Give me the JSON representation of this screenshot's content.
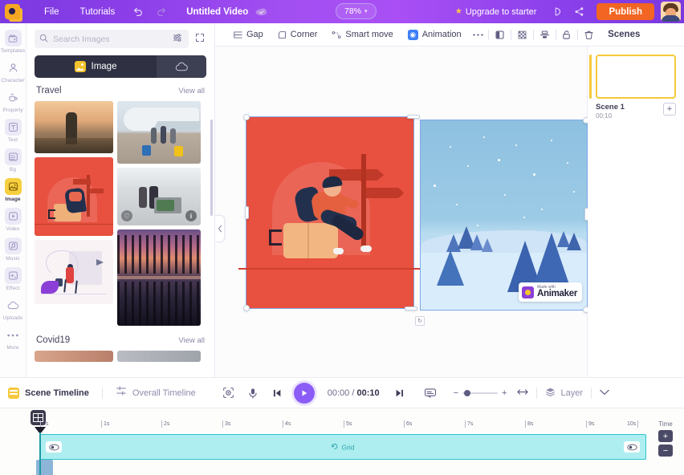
{
  "topbar": {
    "logo": "animaker-logo",
    "menu": [
      {
        "label": "File",
        "name": "file-menu"
      },
      {
        "label": "Tutorials",
        "name": "tutorials-menu"
      }
    ],
    "undo_icon": "undo-icon",
    "redo_icon": "redo-icon",
    "doc_title": "Untitled Video",
    "cloud_icon": "cloud-save-icon",
    "zoom_level": "78%",
    "zoom_caret": "▾",
    "upgrade_label": "Upgrade to starter",
    "upgrade_star": "★",
    "present_icon": "present-icon",
    "share_icon": "share-icon",
    "publish_label": "Publish",
    "avatar": "user-avatar"
  },
  "rail": {
    "items": [
      {
        "label": "Templates",
        "icon": "templates-icon",
        "glyph": "▤"
      },
      {
        "label": "Character",
        "icon": "character-icon",
        "glyph": "●"
      },
      {
        "label": "Property",
        "icon": "property-icon",
        "glyph": "☕"
      },
      {
        "label": "Text",
        "icon": "text-icon",
        "glyph": "T"
      },
      {
        "label": "Bg",
        "icon": "bg-icon",
        "glyph": "☰"
      },
      {
        "label": "Image",
        "icon": "image-icon",
        "glyph": "◰"
      },
      {
        "label": "Video",
        "icon": "video-icon",
        "glyph": "▶"
      },
      {
        "label": "Music",
        "icon": "music-icon",
        "glyph": "♪"
      },
      {
        "label": "Effect",
        "icon": "effect-icon",
        "glyph": "✦"
      },
      {
        "label": "Uploads",
        "icon": "uploads-icon",
        "glyph": "☁"
      },
      {
        "label": "More",
        "icon": "more-icon",
        "glyph": "●●●"
      }
    ],
    "active": "Image"
  },
  "library": {
    "search_placeholder": "Search Images",
    "search_value": "",
    "search_icon": "search-icon",
    "filter_icon": "filter-icon",
    "expand_icon": "expand-icon",
    "toggle_image_label": "Image",
    "toggle_cloud_icon": "cloud-icon",
    "sections": [
      {
        "title": "Travel",
        "view_all": "View all"
      },
      {
        "title": "Covid19",
        "view_all": "View all"
      }
    ]
  },
  "canvas_toolbar": {
    "items": [
      {
        "label": "Gap",
        "icon": "gap-icon"
      },
      {
        "label": "Corner",
        "icon": "corner-icon"
      },
      {
        "label": "Smart move",
        "icon": "smart-move-icon"
      },
      {
        "label": "Animation",
        "icon": "animation-icon"
      }
    ],
    "right_icons": [
      {
        "name": "more-options-icon",
        "glyph": "⋯"
      },
      {
        "name": "split-panel-icon",
        "glyph": "◫"
      },
      {
        "name": "transparency-icon",
        "glyph": "▒"
      },
      {
        "name": "align-icon",
        "glyph": "☰"
      },
      {
        "name": "unlock-icon",
        "glyph": "⚿"
      },
      {
        "name": "delete-icon",
        "glyph": "Ὕ1"
      }
    ],
    "scenes_label": "Scenes"
  },
  "canvas": {
    "collapse_icon": "chevron-left-icon",
    "objects": [
      {
        "name": "red-travel-illustration",
        "selected": true
      },
      {
        "name": "winter-snow-background",
        "selected": true
      }
    ],
    "watermark": {
      "made_with": "Made with",
      "brand": "Animaker"
    },
    "rotate_icon": "rotate-handle-icon"
  },
  "scenes": {
    "cards": [
      {
        "name": "Scene 1",
        "duration": "00:10"
      }
    ],
    "add_label": "+"
  },
  "timeline_bar": {
    "scene_timeline_label": "Scene Timeline",
    "overall_timeline_label": "Overall Timeline",
    "overall_icon": "overall-timeline-icon",
    "record_icon": "record-icon",
    "mic_icon": "microphone-icon",
    "prev_icon": "skip-previous-icon",
    "play_icon": "play-icon",
    "current_time": "00:00",
    "time_separator": "/",
    "total_time": "00:10",
    "next_icon": "skip-next-icon",
    "subtitle_icon": "subtitle-icon",
    "zoom_out_icon": "−",
    "zoom_in_icon": "+",
    "fit_icon": "fit-width-icon",
    "layer_label": "Layer",
    "layer_icon": "layers-icon",
    "chevron_icon": "chevron-down-icon"
  },
  "timeline": {
    "grid_tool_icon": "grid-tool-icon",
    "ticks": [
      "0s",
      "1s",
      "2s",
      "3s",
      "4s",
      "5s",
      "6s",
      "7s",
      "8s",
      "9s",
      "10s"
    ],
    "time_label": "Time",
    "time_plus": "+",
    "time_minus": "−",
    "track_label": "Grid",
    "track_icon": "grid-layer-icon",
    "eye_icon": "visibility-icon"
  }
}
